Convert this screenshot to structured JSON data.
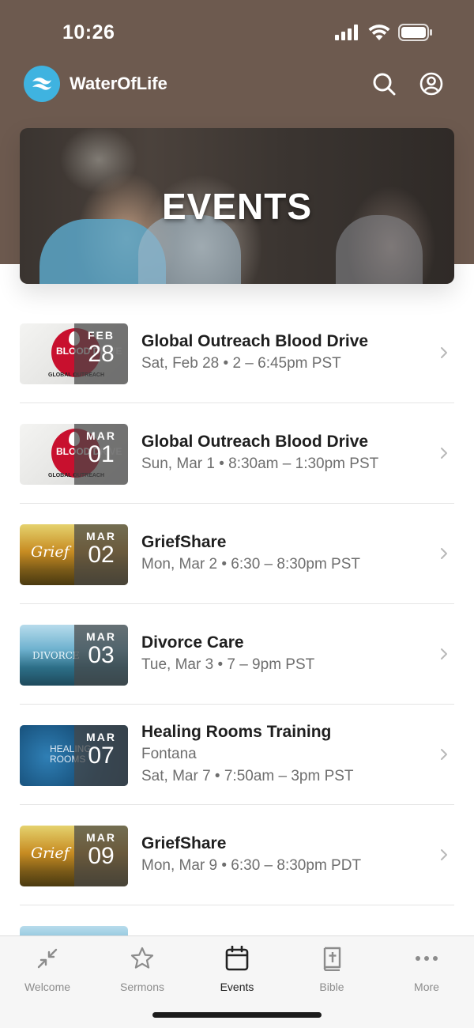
{
  "status_bar": {
    "time": "10:26"
  },
  "header": {
    "brand": "WaterOfLife"
  },
  "hero": {
    "title": "EVENTS"
  },
  "events": [
    {
      "month": "FEB",
      "day": "28",
      "title": "Global Outreach Blood Drive",
      "lines": [
        "Sat, Feb 28 • 2 – 6:45pm PST"
      ],
      "thumb_type": "blood",
      "thumb_text": "BLOOD DRIVE",
      "thumb_footer": "GLOBAL OUTREACH"
    },
    {
      "month": "MAR",
      "day": "01",
      "title": "Global Outreach Blood Drive",
      "lines": [
        "Sun, Mar 1 • 8:30am – 1:30pm PST"
      ],
      "thumb_type": "blood",
      "thumb_text": "BLOOD DRIVE",
      "thumb_footer": "GLOBAL OUTREACH"
    },
    {
      "month": "MAR",
      "day": "02",
      "title": "GriefShare",
      "lines": [
        "Mon, Mar 2 • 6:30 – 8:30pm PST"
      ],
      "thumb_type": "grief",
      "thumb_text": "Grief"
    },
    {
      "month": "MAR",
      "day": "03",
      "title": "Divorce Care",
      "lines": [
        "Tue, Mar 3 • 7 – 9pm PST"
      ],
      "thumb_type": "divorce",
      "thumb_text": "DIVORCE"
    },
    {
      "month": "MAR",
      "day": "07",
      "title": "Healing Rooms Training",
      "lines": [
        "Fontana",
        "Sat, Mar 7 • 7:50am – 3pm PST"
      ],
      "thumb_type": "healing",
      "thumb_text": "HEALING ROOMS"
    },
    {
      "month": "MAR",
      "day": "09",
      "title": "GriefShare",
      "lines": [
        "Mon, Mar 9 • 6:30 – 8:30pm PDT"
      ],
      "thumb_type": "grief",
      "thumb_text": "Grief"
    }
  ],
  "tabs": [
    {
      "label": "Welcome",
      "icon": "welcome-icon"
    },
    {
      "label": "Sermons",
      "icon": "star-icon"
    },
    {
      "label": "Events",
      "icon": "calendar-icon",
      "active": true
    },
    {
      "label": "Bible",
      "icon": "bible-icon"
    },
    {
      "label": "More",
      "icon": "more-icon"
    }
  ],
  "colors": {
    "header_bg": "#6d5a4f",
    "logo_bg": "#3fb3e0",
    "active_tab": "#222222",
    "inactive_tab": "#8c8c8c"
  }
}
